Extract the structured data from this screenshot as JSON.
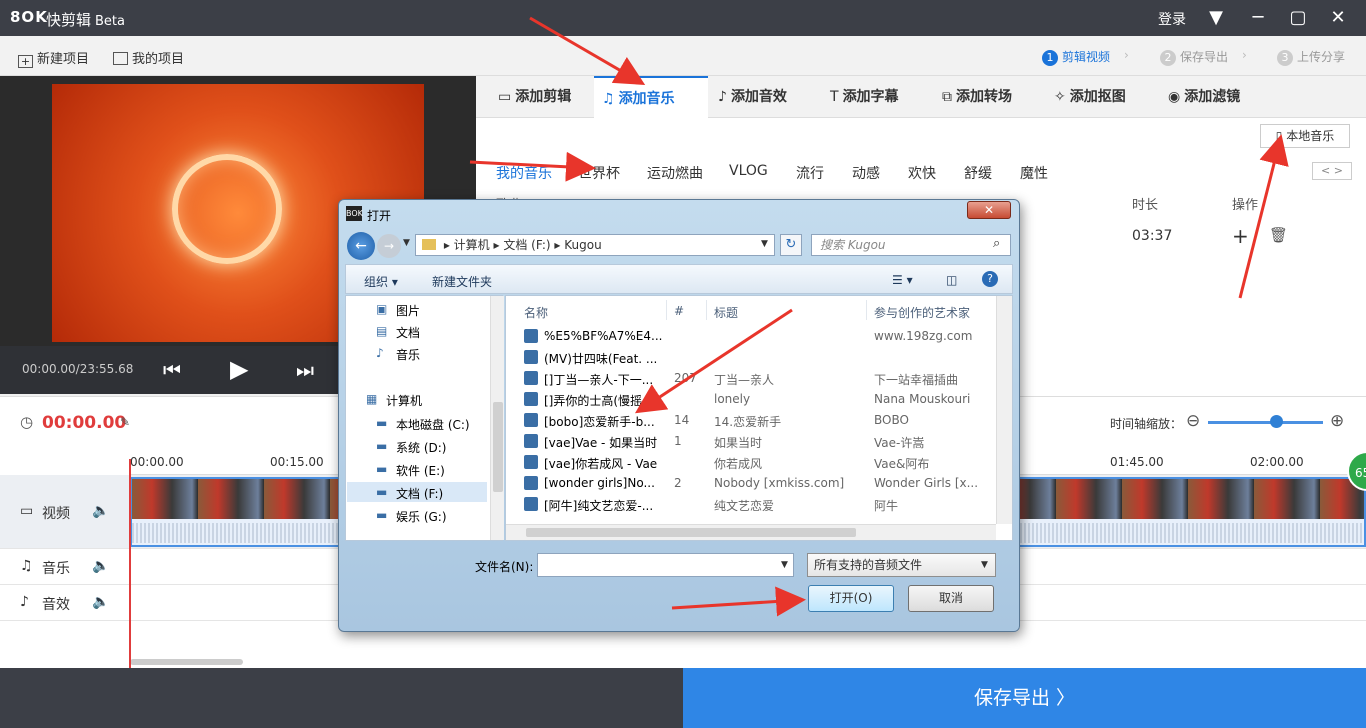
{
  "app": {
    "logo": "8OK",
    "title": "快剪辑",
    "beta": "Beta",
    "login": "登录"
  },
  "toolbar": {
    "new_project": "新建项目",
    "my_projects": "我的项目",
    "steps": [
      {
        "num": "1",
        "label": "剪辑视频"
      },
      {
        "num": "2",
        "label": "保存导出"
      },
      {
        "num": "3",
        "label": "上传分享"
      }
    ]
  },
  "preview": {
    "timecode": "00:00.00/23:55.68"
  },
  "tabs": [
    {
      "icon": "▭",
      "label": "添加剪辑"
    },
    {
      "icon": "♫",
      "label": "添加音乐"
    },
    {
      "icon": "♪",
      "label": "添加音效"
    },
    {
      "icon": "T",
      "label": "添加字幕"
    },
    {
      "icon": "⧉",
      "label": "添加转场"
    },
    {
      "icon": "✧",
      "label": "添加抠图"
    },
    {
      "icon": "◉",
      "label": "添加滤镜"
    }
  ],
  "music": {
    "local_button": "本地音乐",
    "categories": [
      "我的音乐",
      "世界杯",
      "运动燃曲",
      "VLOG",
      "流行",
      "动感",
      "欢快",
      "舒缓",
      "魔性"
    ],
    "category_nav": "< >",
    "columns": {
      "song": "歌曲",
      "duration": "时长",
      "actions": "操作"
    },
    "row": {
      "duration": "03:37"
    }
  },
  "timeline": {
    "time": "00:00.00",
    "zoom_label": "时间轴缩放：",
    "ticks": [
      "00:00.00",
      "00:15.00",
      "01:45.00",
      "02:00.00"
    ],
    "badge": "65",
    "tracks": [
      {
        "name": "视频"
      },
      {
        "name": "音乐"
      },
      {
        "name": "音效"
      }
    ]
  },
  "export_label": "保存导出  〉",
  "dialog": {
    "title": "打开",
    "close": "✕",
    "path": [
      "计算机",
      "文档 (F:)",
      "Kugou"
    ],
    "search_placeholder": "搜索 Kugou",
    "organize": "组织 ▾",
    "new_folder": "新建文件夹",
    "nav": [
      {
        "label": "图片"
      },
      {
        "label": "文档"
      },
      {
        "label": "音乐"
      },
      {
        "label": "计算机"
      },
      {
        "label": "本地磁盘 (C:)"
      },
      {
        "label": "系统 (D:)"
      },
      {
        "label": "软件 (E:)"
      },
      {
        "label": "文档 (F:)"
      },
      {
        "label": "娱乐 (G:)"
      }
    ],
    "columns": {
      "name": "名称",
      "num": "#",
      "title": "标题",
      "artist": "参与创作的艺术家"
    },
    "files": [
      {
        "name": "%E5%BF%A7%E4...",
        "num": "",
        "title": "",
        "artist": "www.198zg.com"
      },
      {
        "name": "(MV)廿四味(Feat. ...",
        "num": "",
        "title": "",
        "artist": ""
      },
      {
        "name": "[]丁当—亲人-下一...",
        "num": "207",
        "title": "丁当—亲人",
        "artist": "下一站幸福插曲"
      },
      {
        "name": "[]弄你的士高(慢摇...",
        "num": "",
        "title": "lonely",
        "artist": "Nana Mouskouri"
      },
      {
        "name": "[bobo]恋爱新手-b...",
        "num": "14",
        "title": "14.恋爱新手",
        "artist": "BOBO"
      },
      {
        "name": "[vae]Vae - 如果当时",
        "num": "1",
        "title": "如果当时",
        "artist": "Vae-许嵩"
      },
      {
        "name": "[vae]你若成风 - Vae",
        "num": "",
        "title": "你若成风",
        "artist": "Vae&阿布"
      },
      {
        "name": "[wonder girls]No...",
        "num": "2",
        "title": "Nobody [xmkiss.com]",
        "artist": "Wonder Girls [x..."
      },
      {
        "name": "[阿牛]纯文艺恋爱-...",
        "num": "",
        "title": "纯文艺恋爱",
        "artist": "阿牛"
      }
    ],
    "filename_label": "文件名(N):",
    "filter": "所有支持的音频文件",
    "open": "打开(O)",
    "cancel": "取消"
  },
  "colors": {
    "accent": "#1a73d9",
    "export": "#2f86e6",
    "arrow": "#e8352b"
  }
}
